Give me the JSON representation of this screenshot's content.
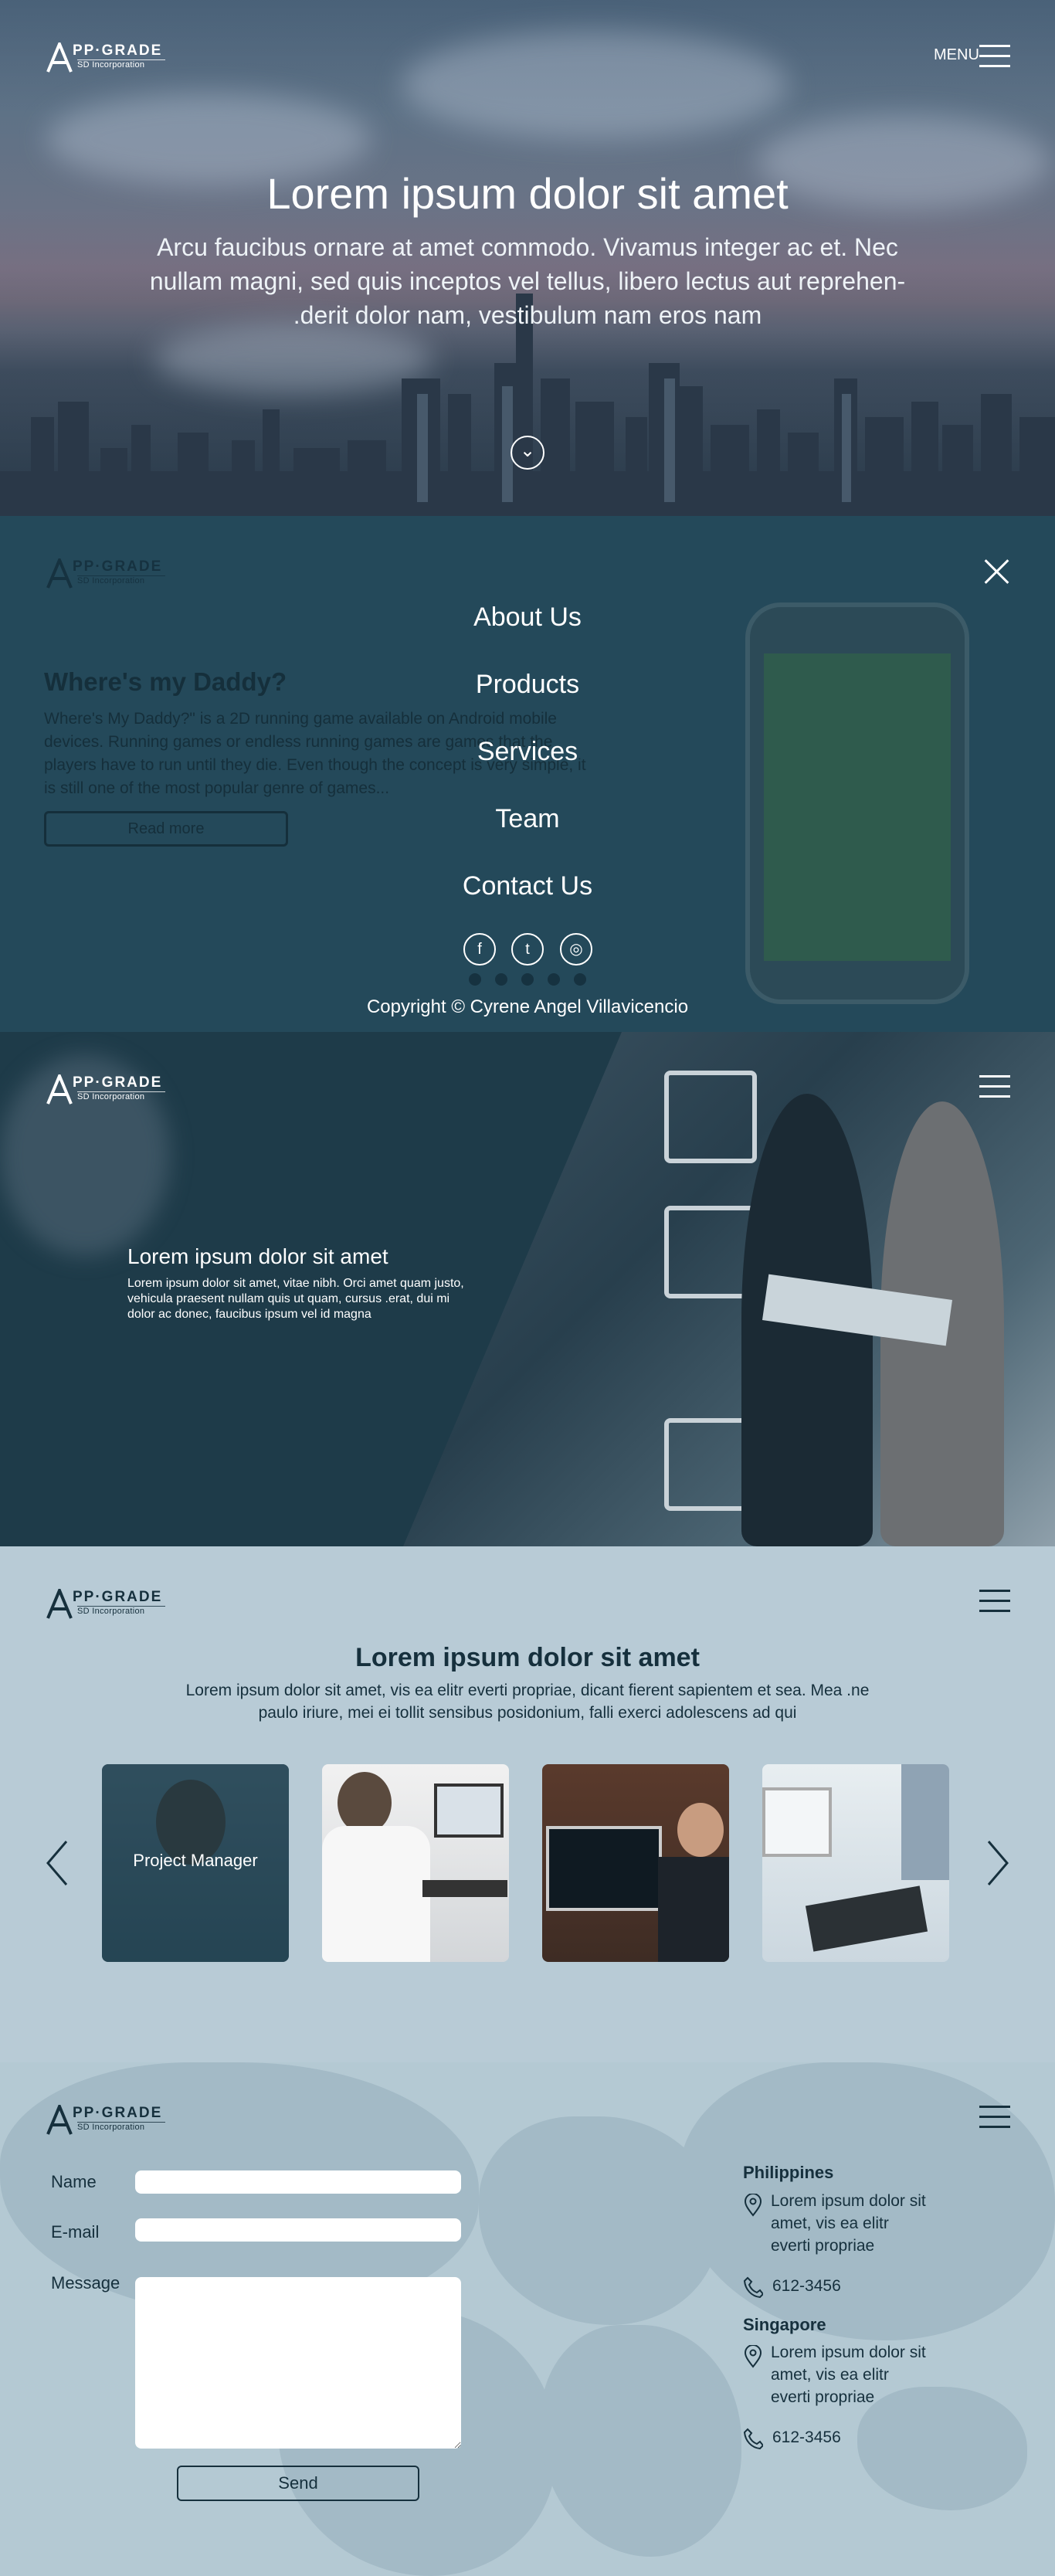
{
  "brand": {
    "name": "PP·GRADE",
    "initial": "A",
    "sub": "SD Incorporation"
  },
  "hero": {
    "menu_label": "MENU",
    "title": "Lorem ipsum dolor sit amet",
    "lead": "Arcu faucibus ornare at amet commodo. Vivamus integer ac et. Nec nullam magni, sed quis inceptos vel tellus, libero lectus aut reprehen- .derit dolor nam, vestibulum nam eros nam",
    "scroll_icon": "chevron-down-icon"
  },
  "overlay": {
    "ghost_title": "Where's my Daddy?",
    "ghost_text": "Where's My Daddy?\" is a 2D running game available on Android mobile devices. Running games or endless running games are games that the players have to run until they die. Even though the concept is very simple, it is still one of the most popular genre of games...",
    "ghost_button": "Read more",
    "nav": [
      "About Us",
      "Products",
      "Services",
      "Team",
      "Contact Us"
    ],
    "social": [
      "f",
      "t",
      "◎"
    ],
    "copyright": "Copyright © Cyrene Angel Villavicencio"
  },
  "business": {
    "title": "Lorem ipsum dolor sit amet",
    "text": "Lorem ipsum dolor sit amet, vitae nibh. Orci amet quam justo, vehicula praesent nullam quis ut quam, cursus .erat, dui mi dolor ac donec, faucibus ipsum vel id magna"
  },
  "team": {
    "title": "Lorem ipsum dolor sit amet",
    "desc": "Lorem ipsum dolor sit amet, vis ea elitr everti propriae, dicant fierent sapientem et sea. Mea .ne paulo iriure, mei ei tollit sensibus posidonium, falli exerci adolescens ad qui",
    "cards": [
      {
        "caption": "Project Manager"
      },
      {
        "caption": ""
      },
      {
        "caption": ""
      },
      {
        "caption": ""
      }
    ]
  },
  "contact": {
    "name_label": "Name",
    "email_label": "E-mail",
    "message_label": "Message",
    "send_label": "Send",
    "offices": [
      {
        "city": "Philippines",
        "address": "Lorem ipsum dolor sit amet, vis ea elitr everti propriae",
        "phone": "612-3456"
      },
      {
        "city": "Singapore",
        "address": "Lorem ipsum dolor sit amet, vis ea elitr everti propriae",
        "phone": "612-3456"
      }
    ]
  }
}
